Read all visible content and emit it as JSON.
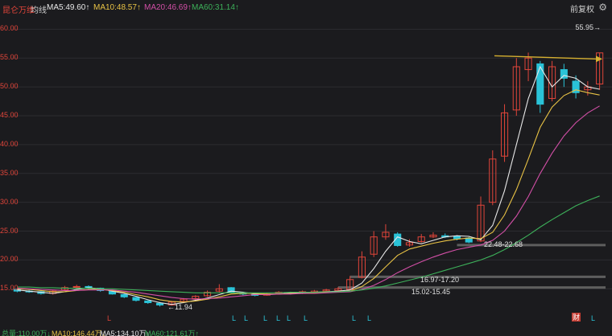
{
  "header": {
    "stock_name": "昆仑万维",
    "mode": "均线",
    "ma5": "MA5:49.60↑",
    "ma10": "MA10:48.57↑",
    "ma20": "MA20:46.69↑",
    "ma60": "MA60:31.14↑",
    "restore_label": "前复权",
    "settings_icon": "gear-icon"
  },
  "y_axis_labels": [
    "60.00",
    "55.00",
    "50.00",
    "45.00",
    "40.00",
    "35.00",
    "30.00",
    "25.00",
    "20.00",
    "15.00"
  ],
  "annotations": {
    "high": "55.95→",
    "support1": "22.48-22.68",
    "support2": "16.97-17.20",
    "support3": "15.02-15.45",
    "low": "←11.94",
    "finance_badge": "财"
  },
  "markers": {
    "low_signal": "L"
  },
  "volume_strip": {
    "vol": "总量:110.00万↓",
    "ma10": "MA10:146.44万↓",
    "ma5": "MA5:134.10万↓",
    "ma60": "MA60:121.61万↑"
  },
  "colors": {
    "background": "#1b1b1e",
    "up": "#e0453a",
    "down": "#2ac3d8",
    "ma5": "#e8e8e8",
    "ma10": "#e8c245",
    "ma20": "#d24fa6",
    "ma60": "#3db15a",
    "arrow": "#d6b030",
    "support_band": "#6a6a6a"
  },
  "chart_data": {
    "type": "candlestick",
    "ylim": [
      11,
      62
    ],
    "series": [
      {
        "name": "MA5",
        "values": [
          14.8,
          14.6,
          14.4,
          14.2,
          14.5,
          14.9,
          15.2,
          15.0,
          14.6,
          14.2,
          13.7,
          13.1,
          12.6,
          12.3,
          12.6,
          13.0,
          13.4,
          14.0,
          14.6,
          14.4,
          14.1,
          14.0,
          14.1,
          14.3,
          14.3,
          14.4,
          14.5,
          14.6,
          14.8,
          16.0,
          18.5,
          21.5,
          24.0,
          23.2,
          22.8,
          23.4,
          24.0,
          24.2,
          24.1,
          23.5,
          26.0,
          32.0,
          40.0,
          48.0,
          53.5,
          50.0,
          52.0,
          51.5,
          50.0,
          49.6
        ]
      },
      {
        "name": "MA10",
        "values": [
          15.0,
          14.9,
          14.7,
          14.5,
          14.5,
          14.7,
          14.9,
          14.9,
          14.7,
          14.4,
          14.0,
          13.6,
          13.1,
          12.8,
          12.7,
          12.9,
          13.2,
          13.6,
          14.1,
          14.2,
          14.2,
          14.1,
          14.1,
          14.2,
          14.2,
          14.3,
          14.4,
          14.5,
          14.6,
          15.4,
          16.8,
          18.8,
          20.8,
          21.9,
          22.4,
          22.9,
          23.3,
          23.6,
          23.8,
          23.7,
          24.8,
          27.8,
          32.2,
          37.5,
          43.0,
          46.5,
          48.5,
          49.5,
          49.0,
          48.6
        ]
      },
      {
        "name": "MA20",
        "values": [
          15.1,
          15.0,
          14.9,
          14.8,
          14.7,
          14.7,
          14.8,
          14.8,
          14.8,
          14.6,
          14.4,
          14.1,
          13.8,
          13.5,
          13.3,
          13.2,
          13.3,
          13.4,
          13.6,
          13.8,
          14.0,
          14.0,
          14.1,
          14.1,
          14.2,
          14.2,
          14.3,
          14.4,
          14.5,
          14.9,
          15.6,
          16.6,
          17.8,
          18.8,
          19.7,
          20.5,
          21.2,
          21.8,
          22.2,
          22.6,
          23.4,
          25.0,
          27.6,
          31.0,
          35.0,
          38.5,
          41.5,
          43.8,
          45.5,
          46.7
        ]
      },
      {
        "name": "MA60",
        "values": [
          15.3,
          15.3,
          15.2,
          15.2,
          15.1,
          15.1,
          15.1,
          15.0,
          15.0,
          14.9,
          14.8,
          14.7,
          14.6,
          14.5,
          14.4,
          14.3,
          14.3,
          14.3,
          14.3,
          14.3,
          14.3,
          14.3,
          14.3,
          14.4,
          14.4,
          14.4,
          14.5,
          14.5,
          14.6,
          14.8,
          15.1,
          15.5,
          16.0,
          16.5,
          17.0,
          17.6,
          18.2,
          18.8,
          19.4,
          20.0,
          20.8,
          21.8,
          23.0,
          24.3,
          25.7,
          27.0,
          28.2,
          29.4,
          30.3,
          31.1
        ]
      }
    ],
    "candles": {
      "open": [
        14.9,
        14.6,
        14.5,
        14.2,
        14.8,
        15.3,
        15.4,
        15.1,
        14.6,
        14.0,
        13.5,
        12.9,
        12.5,
        12.2,
        12.8,
        13.3,
        13.8,
        14.6,
        15.2,
        14.3,
        14.0,
        13.9,
        14.2,
        14.3,
        14.2,
        14.4,
        14.6,
        14.7,
        14.9,
        17.0,
        21.0,
        24.0,
        24.5,
        22.6,
        23.2,
        24.0,
        24.2,
        24.1,
        23.8,
        23.3,
        30.0,
        38.0,
        46.0,
        53.0,
        54.0,
        48.0,
        53.0,
        51.0,
        49.5,
        50.5
      ],
      "close": [
        14.6,
        14.5,
        14.2,
        14.6,
        15.2,
        15.4,
        15.1,
        14.7,
        14.1,
        13.6,
        13.0,
        12.6,
        12.2,
        12.7,
        13.2,
        13.7,
        14.4,
        15.0,
        14.4,
        14.1,
        13.9,
        14.1,
        14.4,
        14.2,
        14.5,
        14.6,
        14.8,
        15.0,
        16.6,
        20.5,
        24.0,
        24.8,
        22.5,
        23.0,
        24.0,
        24.3,
        24.0,
        23.7,
        23.1,
        29.5,
        37.5,
        45.5,
        53.5,
        55.0,
        47.0,
        53.5,
        51.5,
        49.0,
        50.0,
        55.9
      ],
      "high": [
        15.1,
        14.8,
        14.6,
        14.8,
        15.5,
        15.7,
        15.6,
        15.2,
        14.7,
        14.2,
        13.6,
        13.0,
        12.7,
        12.9,
        13.4,
        13.9,
        14.7,
        15.8,
        15.3,
        14.5,
        14.2,
        14.3,
        14.6,
        14.5,
        14.7,
        14.8,
        15.0,
        15.3,
        17.2,
        21.5,
        25.0,
        26.2,
        24.8,
        23.6,
        24.5,
        24.8,
        24.6,
        24.3,
        24.0,
        31.0,
        39.0,
        47.0,
        55.0,
        55.95,
        54.5,
        54.5,
        54.0,
        52.0,
        51.0,
        55.95
      ],
      "low": [
        14.4,
        14.3,
        14.0,
        14.0,
        14.6,
        15.0,
        14.9,
        14.5,
        14.0,
        13.4,
        12.8,
        12.4,
        11.94,
        12.1,
        12.6,
        13.1,
        13.6,
        14.4,
        14.2,
        13.9,
        13.7,
        13.8,
        14.0,
        14.0,
        14.1,
        14.3,
        14.5,
        14.6,
        14.8,
        16.8,
        20.5,
        23.5,
        22.3,
        22.3,
        23.0,
        23.8,
        23.8,
        23.4,
        22.9,
        23.1,
        29.5,
        37.0,
        45.0,
        51.0,
        45.5,
        47.5,
        50.0,
        48.0,
        48.5,
        49.5
      ]
    },
    "support_levels": [
      22.58,
      17.08,
      15.23
    ],
    "target_level": 55.95
  }
}
